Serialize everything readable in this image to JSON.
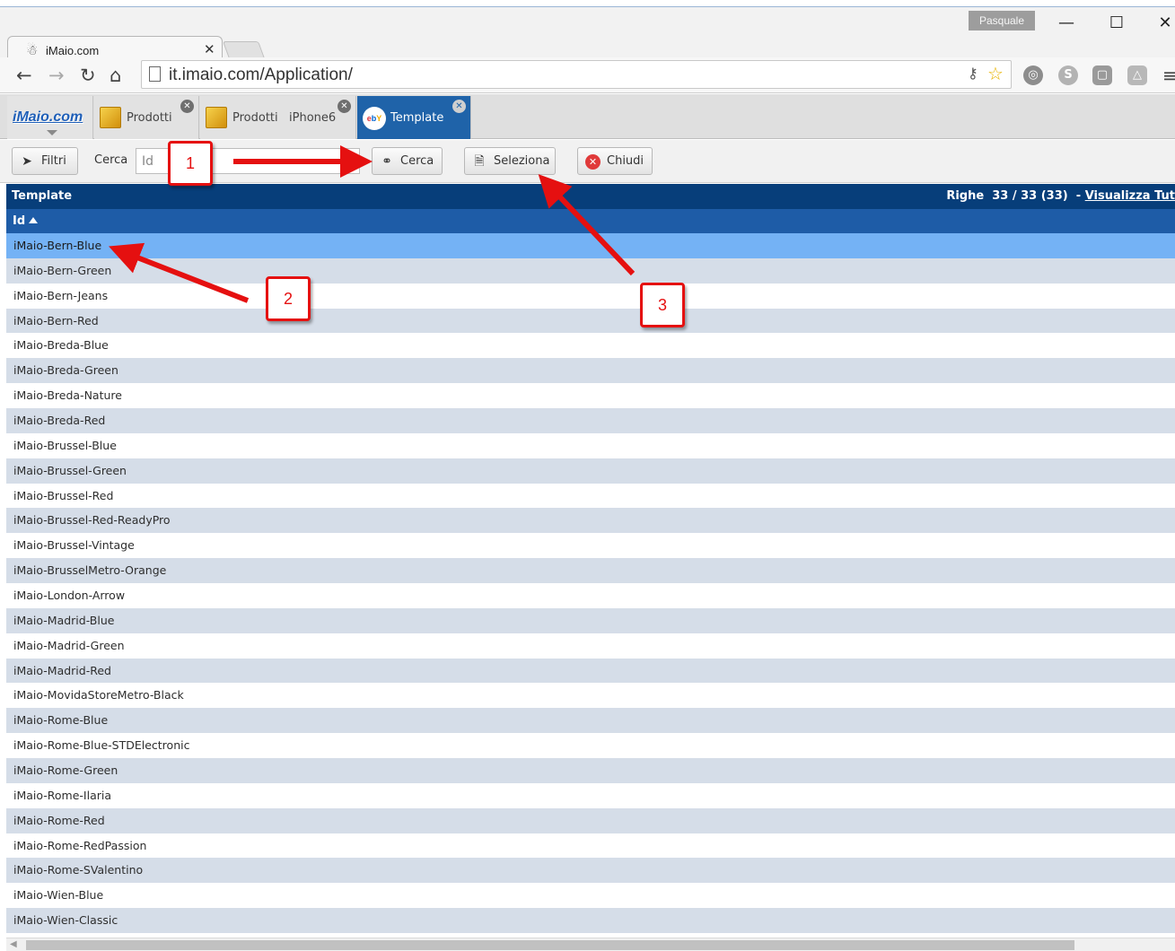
{
  "window": {
    "user": "Pasquale",
    "minimize_glyph": "—",
    "maximize_glyph": "☐",
    "close_glyph": "✕"
  },
  "browser": {
    "tab_title": "iMaio.com",
    "url": "it.imaio.com/Application/",
    "icons": [
      "back-icon",
      "forward-icon",
      "reload-icon",
      "home-icon",
      "page-icon",
      "key-icon",
      "star-icon",
      "extension-icon",
      "menu-icon"
    ]
  },
  "app": {
    "logo": "iMaio.com",
    "tabs": [
      {
        "label": "Prodotti",
        "icon": "box-icon"
      },
      {
        "label": "Prodotti   iPhone6",
        "icon": "box-icon"
      },
      {
        "label": "Template",
        "icon": "ebay-icon",
        "active": true
      }
    ],
    "toolbar": {
      "filtri": "Filtri",
      "cerca_label": "Cerca",
      "search_placeholder": "Id",
      "cerca_button": "Cerca",
      "seleziona_button": "Seleziona",
      "chiudi_button": "Chiudi"
    }
  },
  "grid": {
    "title": "Template",
    "count_text": "Righe  33 / 33 (33)  - ",
    "view_all": "Visualizza Tut",
    "column": "Id",
    "selected_index": 0,
    "rows": [
      "iMaio-Bern-Blue",
      "iMaio-Bern-Green",
      "iMaio-Bern-Jeans",
      "iMaio-Bern-Red",
      "iMaio-Breda-Blue",
      "iMaio-Breda-Green",
      "iMaio-Breda-Nature",
      "iMaio-Breda-Red",
      "iMaio-Brussel-Blue",
      "iMaio-Brussel-Green",
      "iMaio-Brussel-Red",
      "iMaio-Brussel-Red-ReadyPro",
      "iMaio-Brussel-Vintage",
      "iMaio-BrusselMetro-Orange",
      "iMaio-London-Arrow",
      "iMaio-Madrid-Blue",
      "iMaio-Madrid-Green",
      "iMaio-Madrid-Red",
      "iMaio-MovidaStoreMetro-Black",
      "iMaio-Rome-Blue",
      "iMaio-Rome-Blue-STDElectronic",
      "iMaio-Rome-Green",
      "iMaio-Rome-Ilaria",
      "iMaio-Rome-Red",
      "iMaio-Rome-RedPassion",
      "iMaio-Rome-SValentino",
      "iMaio-Wien-Blue",
      "iMaio-Wien-Classic"
    ]
  },
  "annotations": {
    "callouts": [
      "1",
      "2",
      "3"
    ],
    "color": "#e51010"
  },
  "colors": {
    "grid_title_bg": "#073e7a",
    "grid_header_bg": "#1e5ca7",
    "selected_row": "#74b2f5",
    "alt_row": "#d5dde8",
    "active_tab": "#1f63a9"
  }
}
